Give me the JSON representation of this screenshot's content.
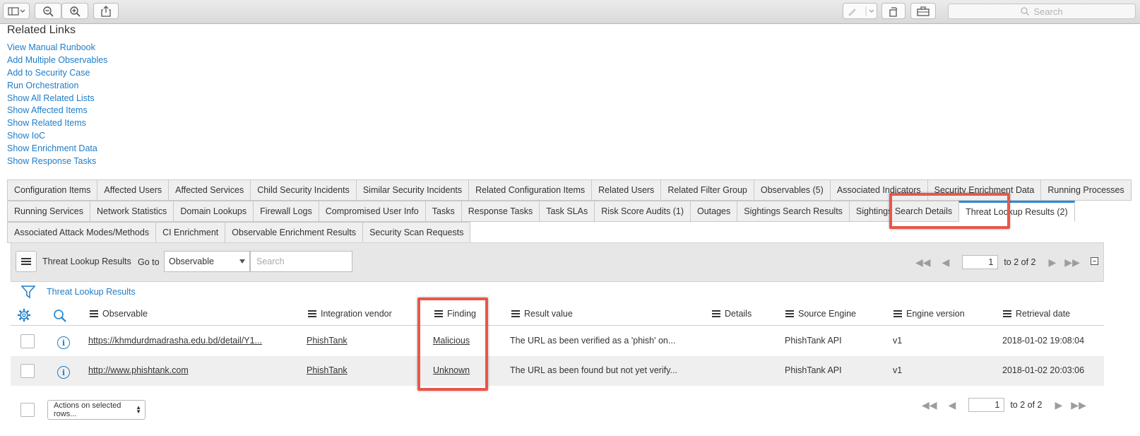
{
  "toolbar": {
    "search_placeholder": "Search"
  },
  "related_links": {
    "title": "Related Links",
    "items": [
      "View Manual Runbook",
      "Add Multiple Observables",
      "Add to Security Case",
      "Run Orchestration",
      "Show All Related Lists",
      "Show Affected Items",
      "Show Related Items",
      "Show IoC",
      "Show Enrichment Data",
      "Show Response Tasks"
    ]
  },
  "tabs": {
    "row1": [
      "Configuration Items",
      "Affected Users",
      "Affected Services",
      "Child Security Incidents",
      "Similar Security Incidents",
      "Related Configuration Items",
      "Related Users",
      "Related Filter Group",
      "Observables (5)",
      "Associated Indicators",
      "Security Enrichment Data",
      "Running Processes"
    ],
    "row2": [
      "Running Services",
      "Network Statistics",
      "Domain Lookups",
      "Firewall Logs",
      "Compromised User Info",
      "Tasks",
      "Response Tasks",
      "Task SLAs",
      "Risk Score Audits (1)",
      "Outages",
      "Sightings Search Results",
      "Sightings Search Details",
      "Threat Lookup Results (2)"
    ],
    "row3": [
      "Associated Attack Modes/Methods",
      "CI Enrichment",
      "Observable Enrichment Results",
      "Security Scan Requests"
    ],
    "active": "Threat Lookup Results (2)"
  },
  "list": {
    "title": "Threat Lookup Results",
    "goto_label": "Go to",
    "goto_value": "Observable",
    "search_placeholder": "Search",
    "page": "1",
    "page_range": "to 2 of 2",
    "filter_label": "Threat Lookup Results",
    "columns": [
      "Observable",
      "Integration vendor",
      "Finding",
      "Result value",
      "Details",
      "Source Engine",
      "Engine version",
      "Retrieval date"
    ],
    "rows": [
      {
        "observable": "https://khmdurdmadrasha.edu.bd/detail/Y1...",
        "vendor": "PhishTank",
        "finding": "Malicious",
        "result": "The URL as been verified as a 'phish' on...",
        "details": "",
        "engine": "PhishTank API",
        "version": "v1",
        "date": "2018-01-02 19:08:04"
      },
      {
        "observable": "http://www.phishtank.com",
        "vendor": "PhishTank",
        "finding": "Unknown",
        "result": "The URL as been found but not yet verify...",
        "details": "",
        "engine": "PhishTank API",
        "version": "v1",
        "date": "2018-01-02 20:03:06"
      }
    ],
    "actions_label": "Actions on selected rows..."
  },
  "colors": {
    "link": "#1f7dc8",
    "highlight": "#e8574a",
    "active_tab": "#2d8ad6"
  }
}
